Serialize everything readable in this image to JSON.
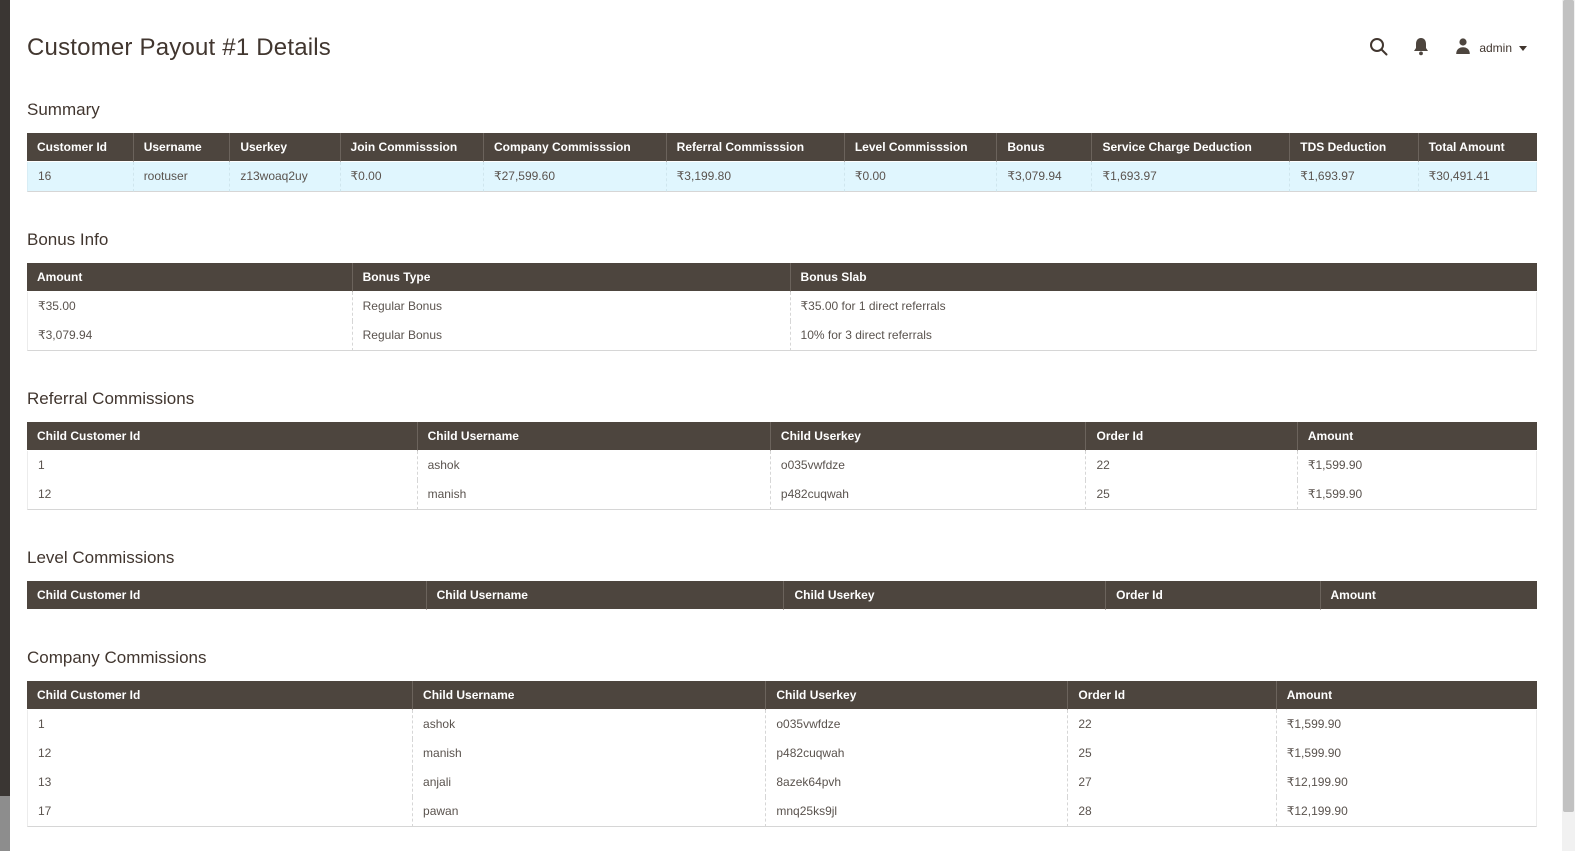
{
  "app": {
    "title": "Customer Payout #1 Details"
  },
  "topbar": {
    "user": {
      "name": "admin"
    },
    "icons": [
      "search-icon",
      "bell-icon",
      "person-icon",
      "chevron-down-icon"
    ]
  },
  "colors": {
    "table_header_bg": "#4d453e",
    "summary_row_bg": "#e0f6fe",
    "sidebar_strip": "#3a3633",
    "heading_text": "#41362f"
  },
  "sections": {
    "summary": {
      "heading": "Summary",
      "columns": [
        "Customer Id",
        "Username",
        "Userkey",
        "Join Commisssion",
        "Company Commisssion",
        "Referral Commisssion",
        "Level Commisssion",
        "Bonus",
        "Service Charge Deduction",
        "TDS Deduction",
        "Total Amount"
      ],
      "rows": [
        [
          "16",
          "rootuser",
          "z13woaq2uy",
          "₹0.00",
          "₹27,599.60",
          "₹3,199.80",
          "₹0.00",
          "₹3,079.94",
          "₹1,693.97",
          "₹1,693.97",
          "₹30,491.41"
        ]
      ]
    },
    "bonus_info": {
      "heading": "Bonus Info",
      "columns": [
        "Amount",
        "Bonus Type",
        "Bonus Slab"
      ],
      "rows": [
        [
          "₹35.00",
          "Regular Bonus",
          "₹35.00 for 1 direct referrals"
        ],
        [
          "₹3,079.94",
          "Regular Bonus",
          "10% for 3 direct referrals"
        ]
      ]
    },
    "referral": {
      "heading": "Referral Commissions",
      "columns": [
        "Child Customer Id",
        "Child Username",
        "Child Userkey",
        "Order Id",
        "Amount"
      ],
      "rows": [
        [
          "1",
          "ashok",
          "o035vwfdze",
          "22",
          "₹1,599.90"
        ],
        [
          "12",
          "manish",
          "p482cuqwah",
          "25",
          "₹1,599.90"
        ]
      ]
    },
    "level": {
      "heading": "Level Commissions",
      "columns": [
        "Child Customer Id",
        "Child Username",
        "Child Userkey",
        "Order Id",
        "Amount"
      ],
      "rows": []
    },
    "company": {
      "heading": "Company Commissions",
      "columns": [
        "Child Customer Id",
        "Child Username",
        "Child Userkey",
        "Order Id",
        "Amount"
      ],
      "rows": [
        [
          "1",
          "ashok",
          "o035vwfdze",
          "22",
          "₹1,599.90"
        ],
        [
          "12",
          "manish",
          "p482cuqwah",
          "25",
          "₹1,599.90"
        ],
        [
          "13",
          "anjali",
          "8azek64pvh",
          "27",
          "₹12,199.90"
        ],
        [
          "17",
          "pawan",
          "mnq25ks9jl",
          "28",
          "₹12,199.90"
        ]
      ]
    }
  }
}
